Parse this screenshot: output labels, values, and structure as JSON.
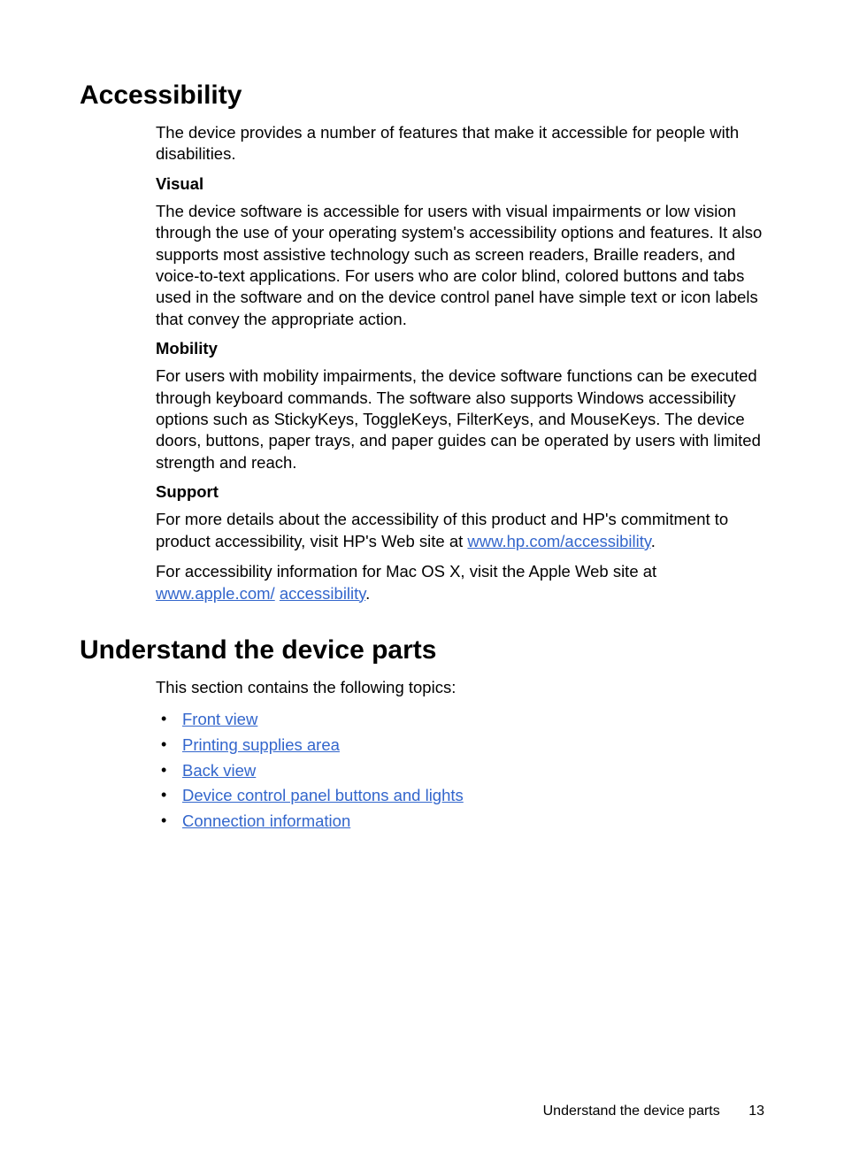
{
  "sections": {
    "accessibility": {
      "heading": "Accessibility",
      "intro": "The device provides a number of features that make it accessible for people with disabilities.",
      "visual": {
        "label": "Visual",
        "text": "The device software is accessible for users with visual impairments or low vision through the use of your operating system's accessibility options and features. It also supports most assistive technology such as screen readers, Braille readers, and voice-to-text applications. For users who are color blind, colored buttons and tabs used in the software and on the device control panel have simple text or icon labels that convey the appropriate action."
      },
      "mobility": {
        "label": "Mobility",
        "text": "For users with mobility impairments, the device software functions can be executed through keyboard commands. The software also supports Windows accessibility options such as StickyKeys, ToggleKeys, FilterKeys, and MouseKeys. The device doors, buttons, paper trays, and paper guides can be operated by users with limited strength and reach."
      },
      "support": {
        "label": "Support",
        "p1_pre": "For more details about the accessibility of this product and HP's commitment to product accessibility, visit HP's Web site at ",
        "p1_link": "www.hp.com/accessibility",
        "p1_post": ".",
        "p2_pre": "For accessibility information for Mac OS X, visit the Apple Web site at ",
        "p2_link1": "www.apple.com/",
        "p2_link2": "accessibility",
        "p2_post": "."
      }
    },
    "understand": {
      "heading": "Understand the device parts",
      "intro": "This section contains the following topics:",
      "topics": [
        "Front view",
        "Printing supplies area",
        "Back view",
        "Device control panel buttons and lights",
        "Connection information"
      ]
    }
  },
  "footer": {
    "title": "Understand the device parts",
    "page": "13"
  }
}
